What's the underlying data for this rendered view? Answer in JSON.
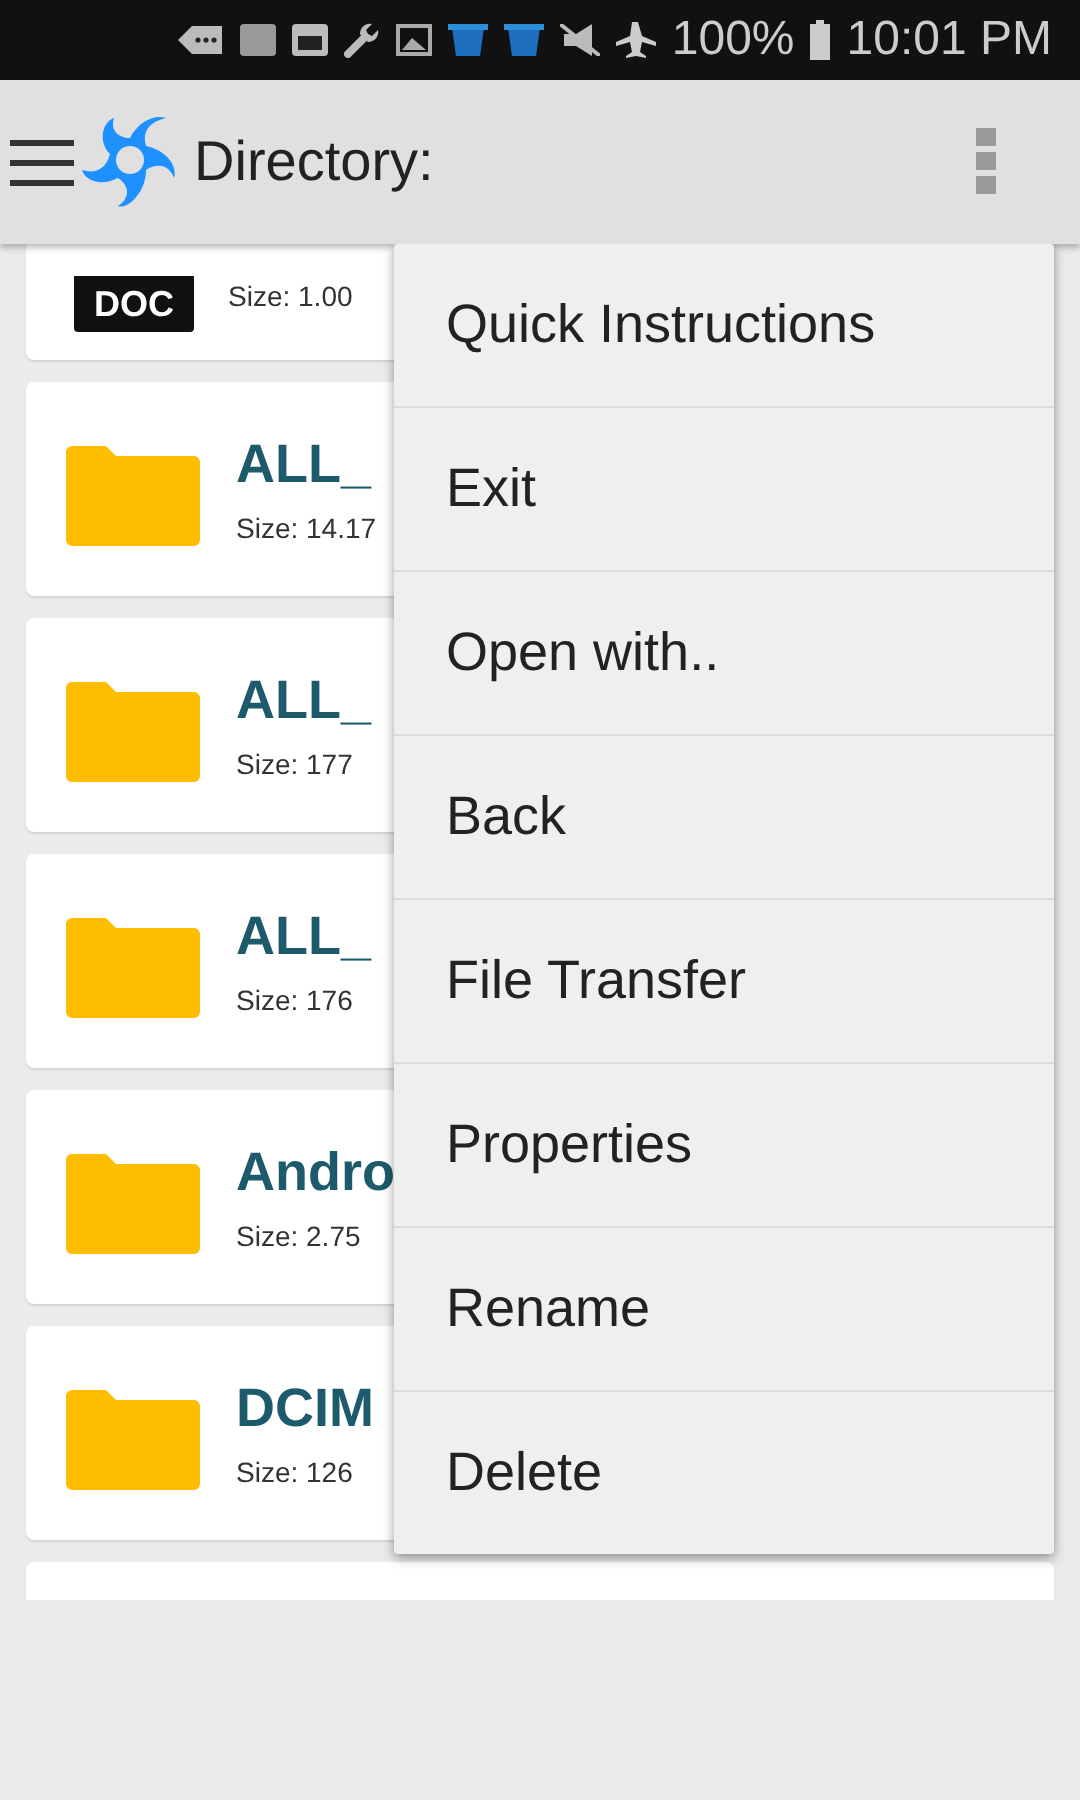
{
  "status_bar": {
    "battery": "100%",
    "time": "10:01 PM"
  },
  "app_bar": {
    "title": "Directory:"
  },
  "files": [
    {
      "kind": "doc",
      "icon_label": "DOC",
      "size": "Size: 1.00"
    },
    {
      "kind": "folder",
      "name": "ALL_",
      "size": "Size: 14.17"
    },
    {
      "kind": "folder",
      "name": "ALL_",
      "size": "Size: 177"
    },
    {
      "kind": "folder",
      "name": "ALL_",
      "size": "Size: 176"
    },
    {
      "kind": "folder",
      "name": "Andro",
      "size": "Size: 2.75"
    },
    {
      "kind": "folder",
      "name": "DCIM",
      "size": "Size: 126"
    },
    {
      "kind": "partial"
    }
  ],
  "menu": [
    "Quick Instructions",
    "Exit",
    "Open with..",
    "Back",
    "File Transfer",
    "Properties",
    "Rename",
    "Delete"
  ]
}
